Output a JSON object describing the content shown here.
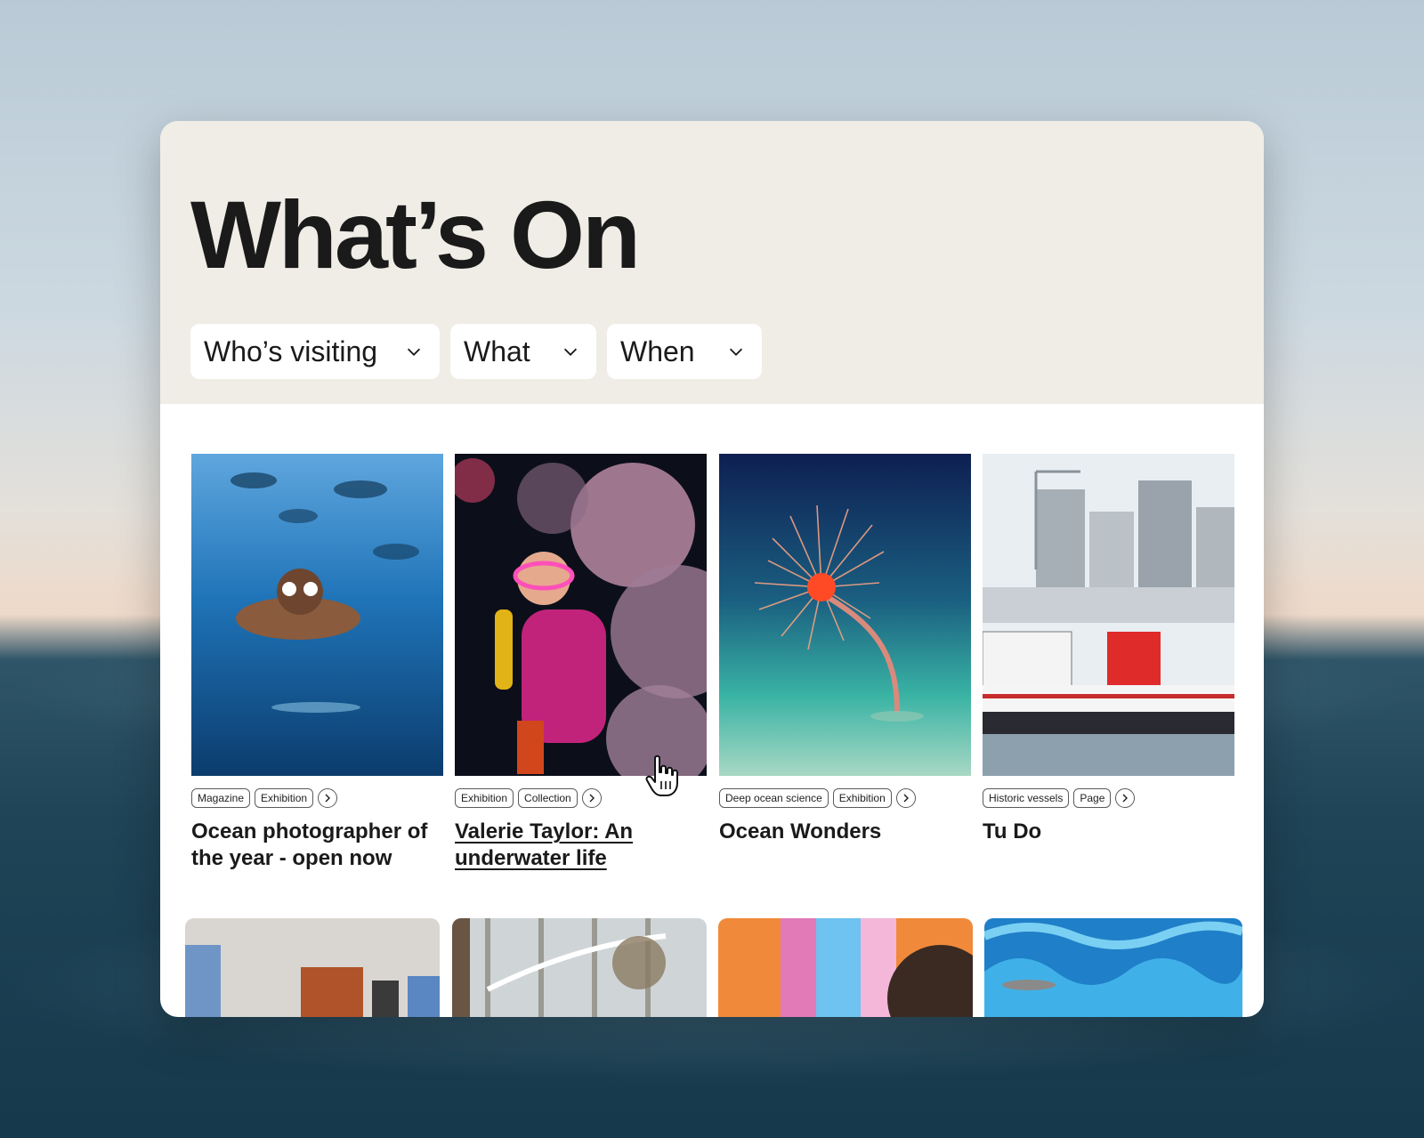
{
  "page": {
    "title": "What’s On"
  },
  "filters": [
    {
      "label": "Who’s visiting",
      "icon": "chevron-down-icon"
    },
    {
      "label": "What",
      "icon": "chevron-down-icon"
    },
    {
      "label": "When",
      "icon": "chevron-down-icon"
    }
  ],
  "items": [
    {
      "tags": [
        "Magazine",
        "Exhibition"
      ],
      "title": "Ocean photographer of the year - open now"
    },
    {
      "tags": [
        "Exhibition",
        "Collection"
      ],
      "title": "Valerie Taylor: An underwater life"
    },
    {
      "tags": [
        "Deep ocean science",
        "Exhibition"
      ],
      "title": "Ocean Wonders"
    },
    {
      "tags": [
        "Historic vessels",
        "Page"
      ],
      "title": "Tu Do"
    }
  ],
  "colors": {
    "hero_background": "#efede6",
    "card_background": "#ffffff",
    "text": "#1a1a1a"
  }
}
